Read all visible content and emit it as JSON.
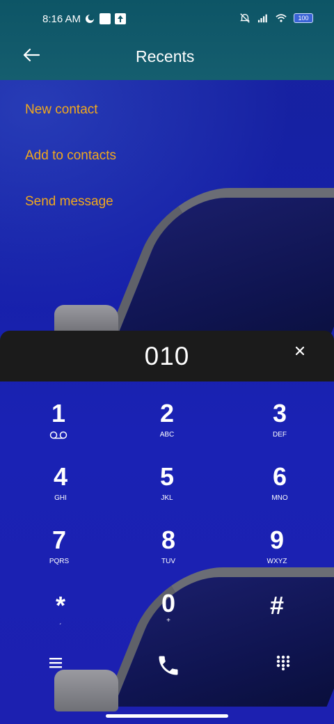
{
  "status_bar": {
    "time": "8:16 AM",
    "battery": "100",
    "icons": [
      "moon-icon",
      "square-icon",
      "upload-icon",
      "mute-icon",
      "signal-icon",
      "wifi-icon",
      "battery-icon"
    ]
  },
  "header": {
    "title": "Recents",
    "back_icon": "back-arrow-icon"
  },
  "options": [
    {
      "label": "New contact"
    },
    {
      "label": "Add to contacts"
    },
    {
      "label": "Send message"
    }
  ],
  "dialer": {
    "number": "010",
    "clear_icon": "close-icon"
  },
  "keypad": [
    {
      "digit": "1",
      "letters": ""
    },
    {
      "digit": "2",
      "letters": "ABC"
    },
    {
      "digit": "3",
      "letters": "DEF"
    },
    {
      "digit": "4",
      "letters": "GHI"
    },
    {
      "digit": "5",
      "letters": "JKL"
    },
    {
      "digit": "6",
      "letters": "MNO"
    },
    {
      "digit": "7",
      "letters": "PQRS"
    },
    {
      "digit": "8",
      "letters": "TUV"
    },
    {
      "digit": "9",
      "letters": "WXYZ"
    },
    {
      "digit": "*",
      "letters": "´"
    },
    {
      "digit": "0",
      "letters": "+"
    },
    {
      "digit": "#",
      "letters": ""
    }
  ],
  "bottom_bar": {
    "icons": [
      "menu-icon",
      "phone-icon",
      "dialpad-icon"
    ]
  },
  "colors": {
    "accent": "#f2a91c",
    "number_bar": "#1b1b1b",
    "background": "#1620a8"
  }
}
